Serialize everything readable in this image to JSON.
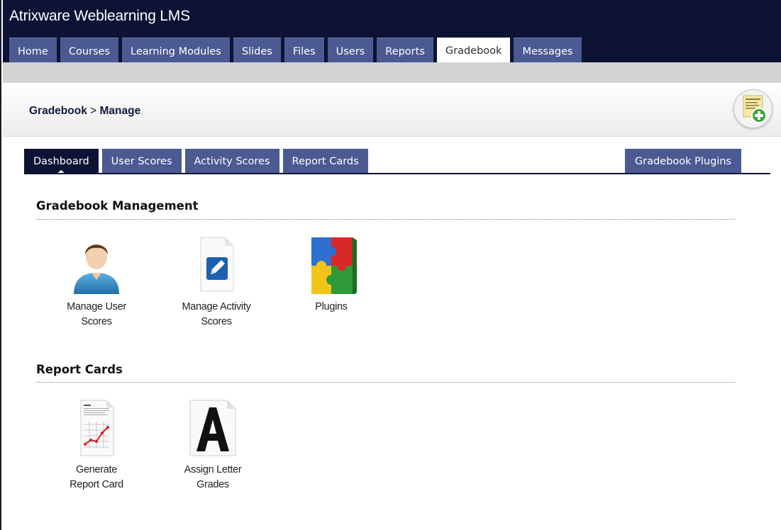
{
  "app": {
    "title": "Atrixware Weblearning LMS"
  },
  "nav": {
    "tabs": [
      {
        "label": "Home"
      },
      {
        "label": "Courses"
      },
      {
        "label": "Learning Modules"
      },
      {
        "label": "Slides"
      },
      {
        "label": "Files"
      },
      {
        "label": "Users"
      },
      {
        "label": "Reports"
      },
      {
        "label": "Gradebook",
        "active": true
      },
      {
        "label": "Messages"
      }
    ]
  },
  "breadcrumb": {
    "parent": "Gradebook",
    "separator": ">",
    "current": "Manage"
  },
  "subtabs": {
    "items": [
      {
        "label": "Dashboard",
        "active": true
      },
      {
        "label": "User Scores"
      },
      {
        "label": "Activity Scores"
      },
      {
        "label": "Report Cards"
      }
    ],
    "right": {
      "label": "Gradebook Plugins"
    }
  },
  "sections": {
    "management": {
      "title": "Gradebook Management",
      "tiles": [
        {
          "line1": "Manage User",
          "line2": "Scores",
          "icon": "user-icon"
        },
        {
          "line1": "Manage Activity",
          "line2": "Scores",
          "icon": "document-edit-icon"
        },
        {
          "line1": "Plugins",
          "line2": "",
          "icon": "puzzle-icon"
        }
      ]
    },
    "report_cards": {
      "title": "Report Cards",
      "tiles": [
        {
          "line1": "Generate",
          "line2": "Report Card",
          "icon": "report-chart-icon"
        },
        {
          "line1": "Assign Letter",
          "line2": "Grades",
          "icon": "letter-a-icon"
        }
      ]
    }
  },
  "colors": {
    "header_bg": "#0c1335",
    "tab_bg": "#4b5a92",
    "subbar_bg": "#d3d3d3",
    "active_tab_bg": "#ffffff"
  }
}
